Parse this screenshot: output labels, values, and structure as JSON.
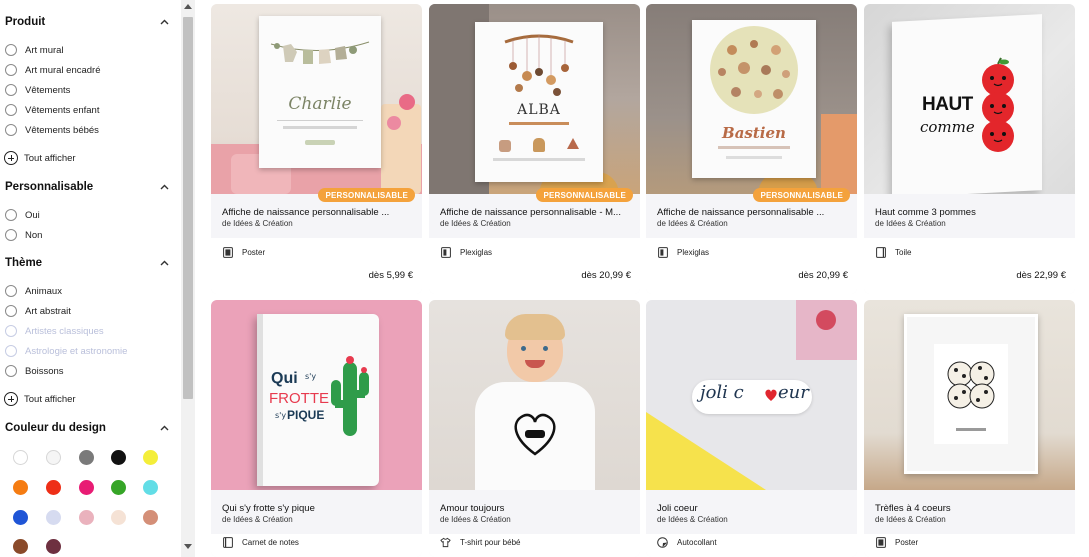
{
  "filters": {
    "product": {
      "title": "Produit",
      "options": [
        "Art mural",
        "Art mural encadré",
        "Vêtements",
        "Vêtements enfant",
        "Vêtements bébés"
      ],
      "show_all": "Tout afficher"
    },
    "customizable": {
      "title": "Personnalisable",
      "options": [
        "Oui",
        "Non"
      ]
    },
    "theme": {
      "title": "Thème",
      "options": [
        "Animaux",
        "Art abstrait",
        "Artistes classiques",
        "Astrologie et astronomie",
        "Boissons"
      ],
      "show_all": "Tout afficher"
    },
    "design_color": {
      "title": "Couleur du design",
      "swatches": [
        "#ffffff",
        "#f5f5f5",
        "#7a7a7a",
        "#111111",
        "#f4ee3a",
        "#f57c12",
        "#ee2f17",
        "#e81c74",
        "#36a527",
        "#62dde6",
        "#1f55d6",
        "#d6dbf0",
        "#eab2bd",
        "#f5e2d5",
        "#d48f78",
        "#8a4a2a",
        "#6e3040"
      ]
    }
  },
  "products": [
    {
      "title": "Affiche de naissance personnalisable ...",
      "by": "de Idées & Création",
      "badge": "PERSONNALISABLE",
      "type": "Poster",
      "price": "dès 5,99 €",
      "art_name": "Charlie"
    },
    {
      "title": "Affiche de naissance personnalisable - M...",
      "by": "de Idées & Création",
      "badge": "PERSONNALISABLE",
      "type": "Plexiglas",
      "price": "dès 20,99 €",
      "art_name": "ALBA"
    },
    {
      "title": "Affiche de naissance personnalisable ...",
      "by": "de Idées & Création",
      "badge": "PERSONNALISABLE",
      "type": "Plexiglas",
      "price": "dès 20,99 €",
      "art_name": "Bastien"
    },
    {
      "title": "Haut comme 3 pommes",
      "by": "de Idées & Création",
      "type": "Toile",
      "price": "dès 22,99 €",
      "art_line1": "HAUT",
      "art_line2": "comme"
    },
    {
      "title": "Qui s'y frotte s'y pique",
      "by": "de Idées & Création",
      "type": "Carnet de notes",
      "art_line1": "Qui",
      "art_line2": "s'y",
      "art_line3": "FROTTE",
      "art_line4": "s'y",
      "art_line5": "PIQUE"
    },
    {
      "title": "Amour toujours",
      "by": "de Idées & Création",
      "type": "T-shirt pour bébé"
    },
    {
      "title": "Joli coeur",
      "by": "de Idées & Création",
      "type": "Autocollant",
      "art_line1": "joli c",
      "art_line2": "eur"
    },
    {
      "title": "Trèfles à 4 coeurs",
      "by": "de Idées & Création",
      "type": "Poster"
    }
  ],
  "colors": {
    "badge": "#f4a23c",
    "card_bg": "#f5f5f8",
    "faded_text": "#b9bfda"
  }
}
